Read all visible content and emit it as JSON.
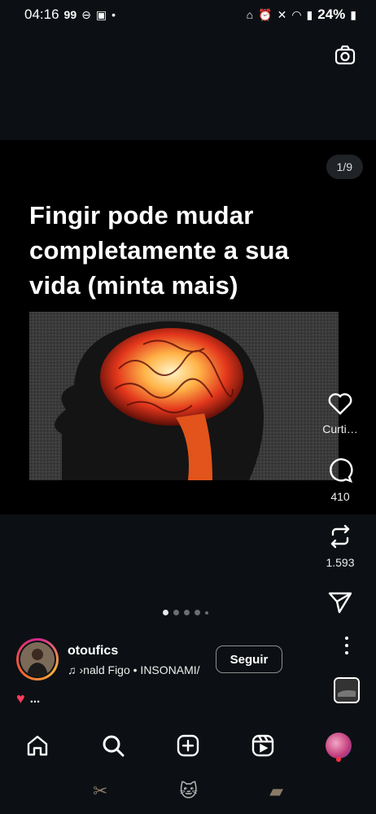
{
  "status_bar": {
    "time": "04:16",
    "network_badge": "99",
    "battery": "24%"
  },
  "post": {
    "counter": "1/9",
    "headline": "Fingir pode mudar completamente a sua vida (minta mais)"
  },
  "actions": {
    "like_label": "Curti…",
    "comment_count": "410",
    "repost_count": "1.593"
  },
  "carousel": {
    "dots": 5,
    "active": 0
  },
  "author": {
    "username": "otoufics",
    "music": "›nald Figo • INSONAMI/",
    "follow_label": "Seguir"
  },
  "likes": {
    "text": "..."
  },
  "colors": {
    "background": "#0c1014",
    "card": "#000000",
    "accent": "#ff3040"
  }
}
